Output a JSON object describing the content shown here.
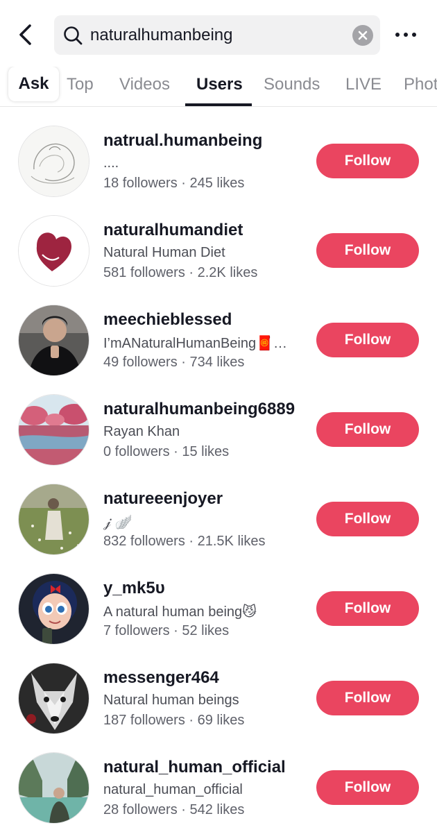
{
  "search": {
    "query": "naturalhumanbeing"
  },
  "tabs": [
    {
      "label": "Ask"
    },
    {
      "label": "Top"
    },
    {
      "label": "Videos"
    },
    {
      "label": "Users"
    },
    {
      "label": "Sounds"
    },
    {
      "label": "LIVE"
    },
    {
      "label": "Photos"
    }
  ],
  "active_tab": "Users",
  "icons": {
    "back": "chevron-left-icon",
    "search": "search-icon",
    "clear": "clear-icon",
    "more": "more-horizontal-icon"
  },
  "colors": {
    "follow_button": "#ea4560",
    "search_bg": "#f1f1f2",
    "active_tab": "#161823",
    "inactive_tab": "#8a8b91"
  },
  "users": [
    {
      "username": "natrual.humanbeing",
      "bio": "....",
      "stats": "18 followers · 245 likes",
      "follow_label": "Follow"
    },
    {
      "username": "naturalhumandiet",
      "bio": "Natural Human Diet",
      "stats": "581 followers · 2.2K likes",
      "follow_label": "Follow"
    },
    {
      "username": "meechieblessed",
      "bio": "I’mANaturalHumanBeing🧧…",
      "stats": "49 followers · 734 likes",
      "follow_label": "Follow"
    },
    {
      "username": "naturalhumanbeing6889",
      "bio": "Rayan Khan",
      "stats": "0 followers · 15 likes",
      "follow_label": "Follow"
    },
    {
      "username": "natureeenjoyer",
      "bio": "𝒿 🪽",
      "stats": "832 followers · 21.5K likes",
      "follow_label": "Follow"
    },
    {
      "username": "y_mk5υ",
      "bio": "A natural human being😼",
      "stats": "7 followers · 52 likes",
      "follow_label": "Follow"
    },
    {
      "username": "messenger464",
      "bio": "Natural human beings",
      "stats": "187 followers · 69 likes",
      "follow_label": "Follow"
    },
    {
      "username": "natural_human_official",
      "bio": "natural_human_official",
      "stats": "28 followers · 542 likes",
      "follow_label": "Follow"
    }
  ]
}
